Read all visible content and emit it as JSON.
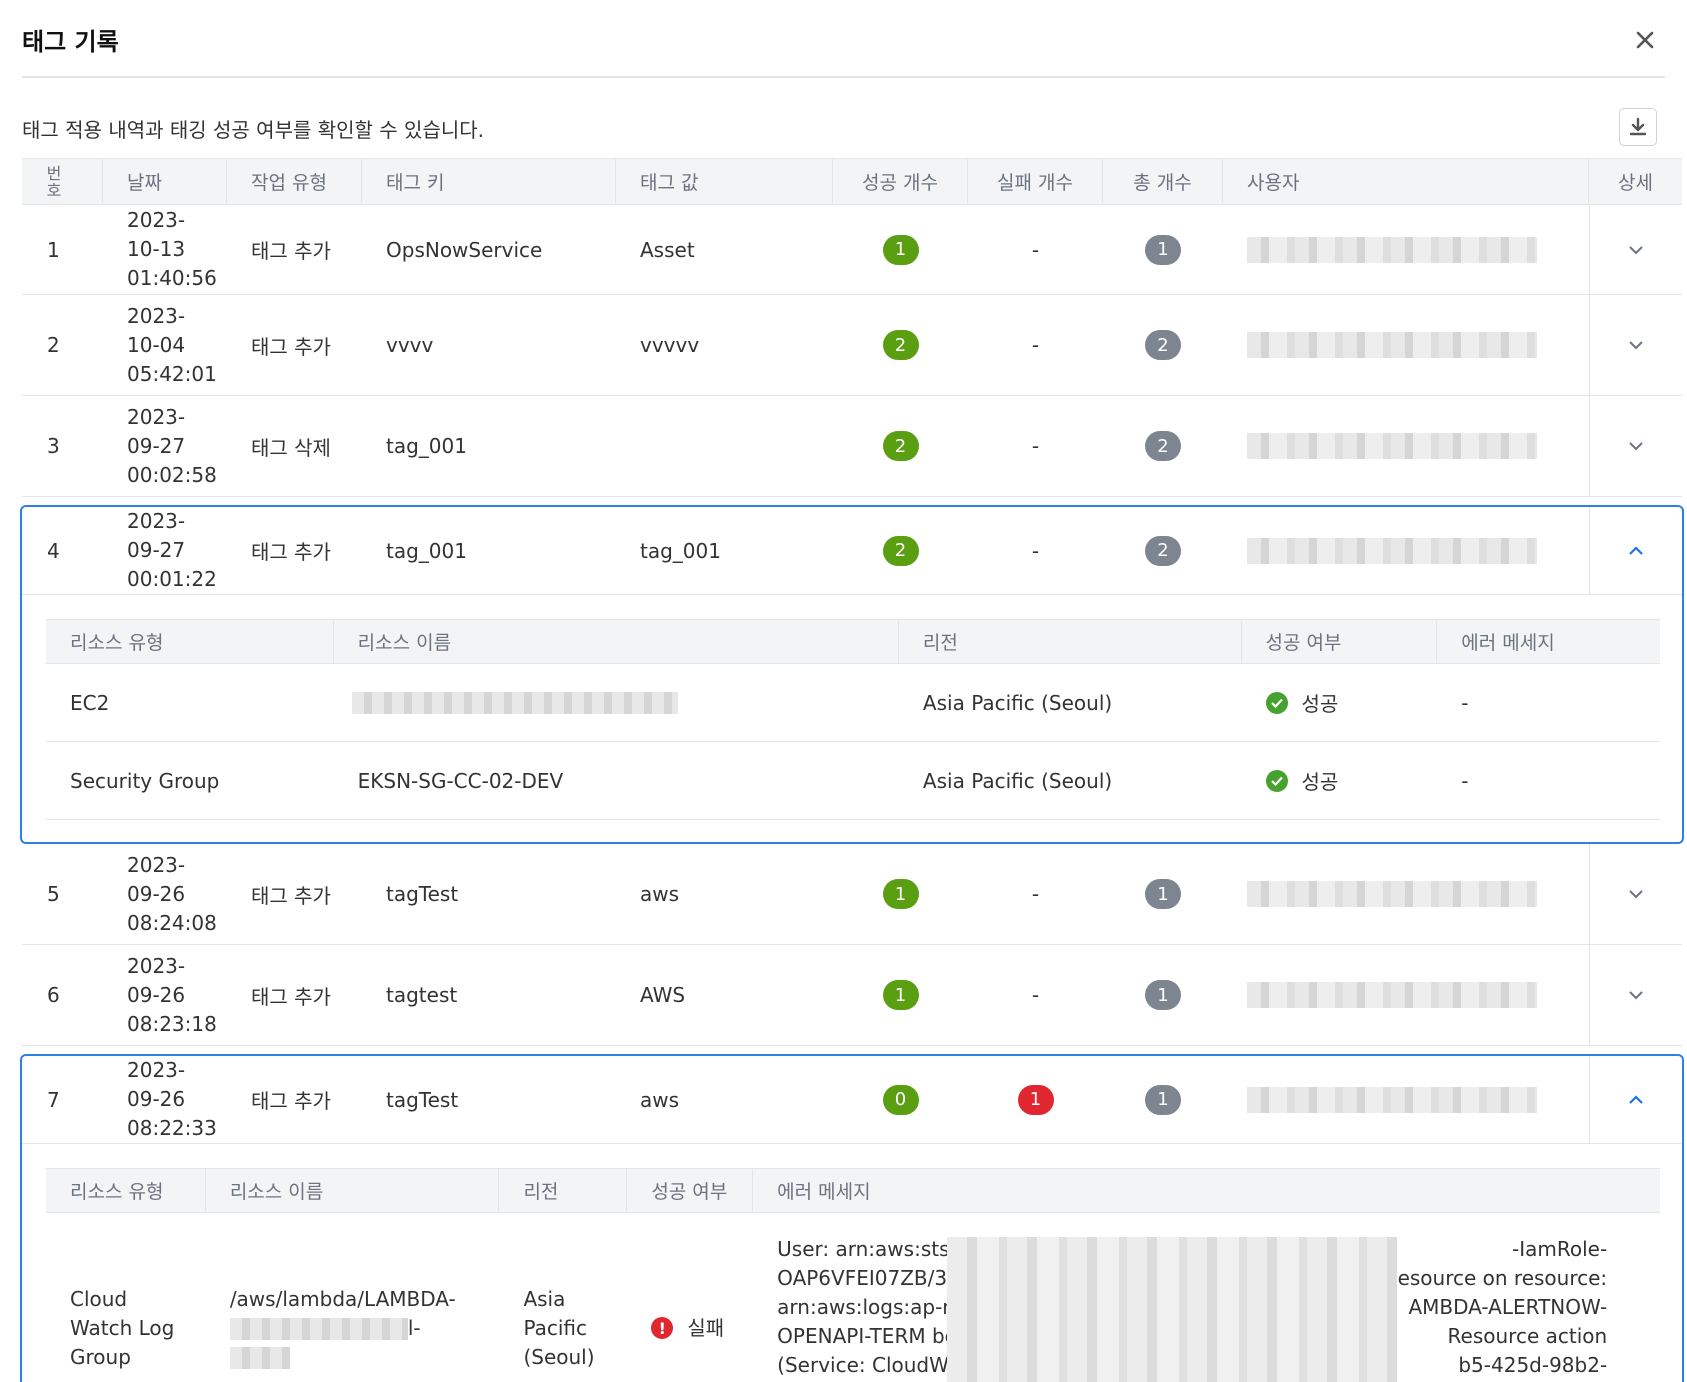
{
  "dialog": {
    "title": "태그 기록",
    "description": "태그 적용 내역과 태깅 성공 여부를 확인할 수 있습니다."
  },
  "columns": {
    "num": "번호",
    "date": "날짜",
    "type": "작업 유형",
    "key": "태그 키",
    "value": "태그 값",
    "success": "성공 개수",
    "fail": "실패 개수",
    "total": "총 개수",
    "user": "사용자",
    "detail": "상세"
  },
  "rows": [
    {
      "num": "1",
      "date1": "2023-",
      "date2": "10-13",
      "date3": "01:40:56",
      "type": "태그 추가",
      "key": "OpsNowService",
      "value": "Asset",
      "success": "1",
      "fail": "-",
      "total": "1"
    },
    {
      "num": "2",
      "date1": "2023-",
      "date2": "10-04",
      "date3": "05:42:01",
      "type": "태그 추가",
      "key": "vvvv",
      "value": "vvvvv",
      "success": "2",
      "fail": "-",
      "total": "2"
    },
    {
      "num": "3",
      "date1": "2023-",
      "date2": "09-27",
      "date3": "00:02:58",
      "type": "태그 삭제",
      "key": "tag_001",
      "value": "",
      "success": "2",
      "fail": "-",
      "total": "2"
    },
    {
      "num": "4",
      "date1": "2023-",
      "date2": "09-27",
      "date3": "00:01:22",
      "type": "태그 추가",
      "key": "tag_001",
      "value": "tag_001",
      "success": "2",
      "fail": "-",
      "total": "2"
    },
    {
      "num": "5",
      "date1": "2023-",
      "date2": "09-26",
      "date3": "08:24:08",
      "type": "태그 추가",
      "key": "tagTest",
      "value": "aws",
      "success": "1",
      "fail": "-",
      "total": "1"
    },
    {
      "num": "6",
      "date1": "2023-",
      "date2": "09-26",
      "date3": "08:23:18",
      "type": "태그 추가",
      "key": "tagtest",
      "value": "AWS",
      "success": "1",
      "fail": "-",
      "total": "1"
    },
    {
      "num": "7",
      "date1": "2023-",
      "date2": "09-26",
      "date3": "08:22:33",
      "type": "태그 추가",
      "key": "tagTest",
      "value": "aws",
      "success": "0",
      "fail": "1",
      "total": "1"
    }
  ],
  "sub_columns": {
    "rtype": "리소스 유형",
    "rname": "리소스 이름",
    "region": "리전",
    "status": "성공 여부",
    "error": "에러 메세지"
  },
  "detail4": [
    {
      "rtype": "EC2",
      "rname": "",
      "region": "Asia Pacific (Seoul)",
      "status": "성공",
      "error": "-"
    },
    {
      "rtype": "Security Group",
      "rname": "EKSN-SG-CC-02-DEV",
      "region": "Asia Pacific (Seoul)",
      "status": "성공",
      "error": "-"
    }
  ],
  "detail7": {
    "rtype1": "Cloud",
    "rtype2": "Watch Log",
    "rtype3": "Group",
    "rname1": "/aws/lambda/LAMBDA-",
    "rname2": "l-",
    "region1": "Asia",
    "region2": "Pacific",
    "region3": "(Seoul)",
    "status": "실패",
    "err1a": "User: arn:aws:sts::",
    "err1b": "-IamRole-",
    "err2a": "OAP6VFEI07ZB/37",
    "err2b": "esource on resource:",
    "err3a": "arn:aws:logs:ap-no",
    "err3b": "AMBDA-ALERTNOW-",
    "err4a": "OPENAPI-TERM be",
    "err4b": "Resource action",
    "err5a": "(Service: CloudWat",
    "err5b": "b5-425d-98b2-"
  },
  "icons": {
    "close": "close-icon",
    "download": "download-icon",
    "expand": "chevron-down-icon",
    "collapse": "chevron-up-icon",
    "success": "check-circle-icon",
    "fail": "error-circle-icon"
  },
  "colors": {
    "success_badge": "#5a9e12",
    "fail_badge": "#e0262f",
    "total_badge": "#7d8591",
    "accent": "#2f7fe6"
  }
}
